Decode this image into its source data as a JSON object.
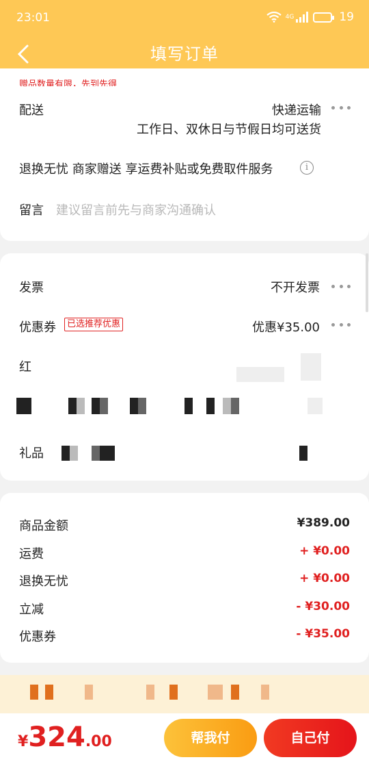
{
  "status_bar": {
    "time": "23:01",
    "network": "4G",
    "battery": "19"
  },
  "header": {
    "title": "填写订单"
  },
  "notice": "赠品数量有限，先到先得",
  "delivery": {
    "label": "配送",
    "method": "快递运输",
    "detail": "工作日、双休日与节假日均可送货"
  },
  "return_service": {
    "text": "退换无忧 商家赠送  享运费补贴或免费取件服务"
  },
  "message": {
    "label": "留言",
    "placeholder": "建议留言前先与商家沟通确认"
  },
  "invoice": {
    "label": "发票",
    "value": "不开发票"
  },
  "coupon": {
    "label": "优惠券",
    "tag": "已选推荐优惠",
    "value": "优惠¥35.00"
  },
  "blurred_row_1": {
    "label": "红"
  },
  "gift": {
    "label": "礼品"
  },
  "summary": [
    {
      "label": "商品金额",
      "value": "¥389.00",
      "color": "#222222"
    },
    {
      "label": "运费",
      "value": "+ ¥0.00",
      "color": "#e02020"
    },
    {
      "label": "退换无忧",
      "value": "+ ¥0.00",
      "color": "#e02020"
    },
    {
      "label": "立减",
      "value": "- ¥30.00",
      "color": "#e02020"
    },
    {
      "label": "优惠券",
      "value": "- ¥35.00",
      "color": "#e02020"
    }
  ],
  "footer": {
    "currency": "¥",
    "price_int": "324",
    "price_dec": ".00",
    "help_pay_label": "帮我付",
    "self_pay_label": "自己付"
  },
  "colors": {
    "brand": "#fec855",
    "accent_red": "#e02020",
    "help_btn": "#fcb030"
  },
  "icons": [
    "back-arrow-icon",
    "wifi-icon",
    "signal-icon",
    "battery-icon",
    "info-icon",
    "more-dots-icon"
  ]
}
